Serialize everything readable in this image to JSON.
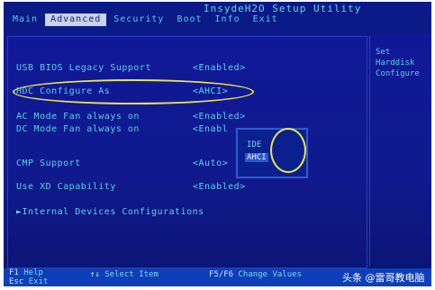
{
  "bios": {
    "title": "InsydeH2O Setup Utility",
    "tabs": [
      {
        "label": "Main"
      },
      {
        "label": "Advanced"
      },
      {
        "label": "Security"
      },
      {
        "label": "Boot"
      },
      {
        "label": "Info"
      },
      {
        "label": "Exit"
      }
    ],
    "active_tab": "Advanced",
    "help_text": "Set Harddisk\nConfigure",
    "settings": [
      {
        "label": "USB BIOS Legacy Support",
        "value": "<Enabled>"
      },
      {
        "label": "HDC Configure As",
        "value": "<AHCI>"
      },
      {
        "label": "AC Mode Fan always on",
        "value": "<Enabled>"
      },
      {
        "label": "DC Mode Fan always on",
        "value": "<Enabl"
      },
      {
        "label": "CMP Support",
        "value": "<Auto>"
      },
      {
        "label": "Use XD Capability",
        "value": "<Enabled>"
      },
      {
        "label": "►Internal Devices Configurations",
        "value": ""
      }
    ],
    "popup_options": [
      "IDE",
      "AHCI"
    ],
    "popup_selected": "AHCI",
    "bottom_bar": [
      {
        "key": "F1",
        "text": "Help"
      },
      {
        "key": "Esc",
        "text": "Exit"
      },
      {
        "key": "↑↓",
        "text": "Select Item"
      },
      {
        "key": "F5/F6",
        "text": "Change Values"
      }
    ]
  },
  "watermark": "头条 @雷哥教电脑",
  "colors": {
    "background": "#101a8e",
    "text": "#56d2e2",
    "active_tab_bg": "#c8d3e6",
    "annotation": "#e9e54a",
    "selection": "#2a57cf"
  }
}
